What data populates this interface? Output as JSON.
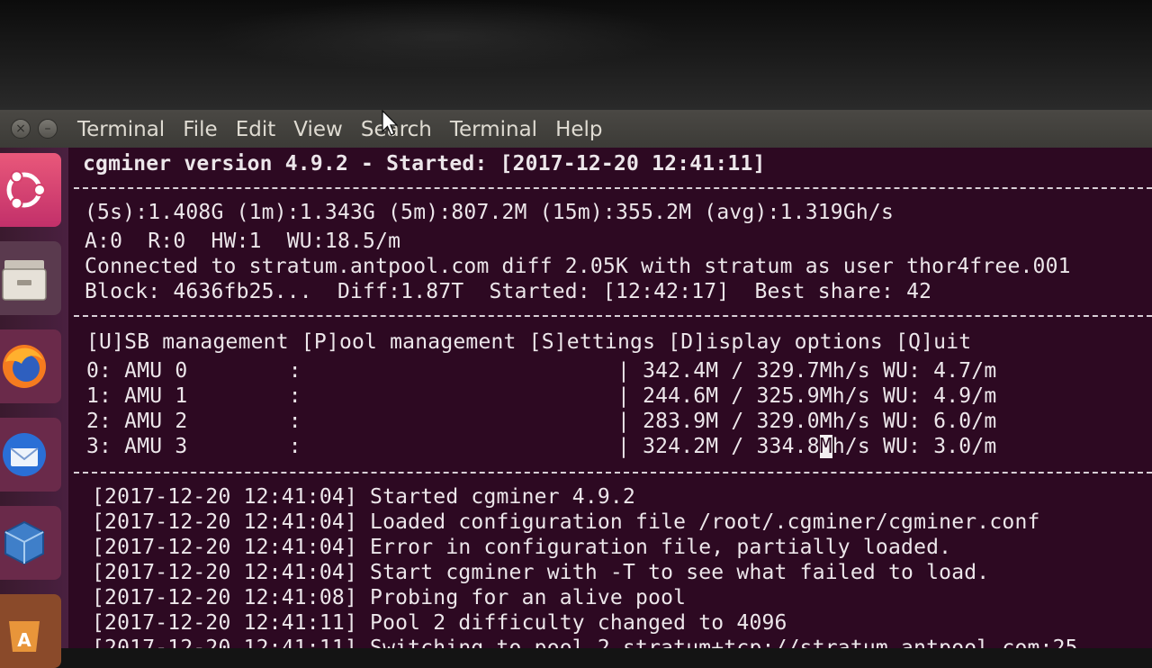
{
  "menubar": {
    "items": [
      "Terminal",
      "File",
      "Edit",
      "View",
      "Search",
      "Terminal",
      "Help"
    ]
  },
  "launcher": {
    "items": [
      "ubuntu-icon",
      "files-icon",
      "firefox-icon",
      "thunderbird-icon",
      "virtualbox-icon",
      "software-center-icon"
    ]
  },
  "terminal": {
    "header": "cgminer version 4.9.2 - Started: [2017-12-20 12:41:11]",
    "stats_rate": "(5s):1.408G (1m):1.343G (5m):807.2M (15m):355.2M (avg):1.319Gh/s",
    "stats_counts": "A:0  R:0  HW:1  WU:18.5/m",
    "connection": "Connected to stratum.antpool.com diff 2.05K with stratum as user thor4free.001",
    "block": "Block: 4636fb25...  Diff:1.87T  Started: [12:42:17]  Best share: 42",
    "menu": "[U]SB management [P]ool management [S]ettings [D]isplay options [Q]uit",
    "devices": [
      "0: AMU 0        :                         | 342.4M / 329.7Mh/s WU: 4.7/m",
      "1: AMU 1        :                         | 244.6M / 325.9Mh/s WU: 4.9/m",
      "2: AMU 2        :                         | 283.9M / 329.0Mh/s WU: 6.0/m"
    ],
    "device_last_before_cursor": "3: AMU 3        :                         | 324.2M / 334.8",
    "device_last_cursor_char": "M",
    "device_last_after_cursor": "h/s WU: 3.0/m",
    "log": [
      "[2017-12-20 12:41:04] Started cgminer 4.9.2",
      "[2017-12-20 12:41:04] Loaded configuration file /root/.cgminer/cgminer.conf",
      "[2017-12-20 12:41:04] Error in configuration file, partially loaded.",
      "[2017-12-20 12:41:04] Start cgminer with -T to see what failed to load.",
      "[2017-12-20 12:41:08] Probing for an alive pool",
      "[2017-12-20 12:41:11] Pool 2 difficulty changed to 4096",
      "[2017-12-20 12:41:11] Switching to pool 2 stratum+tcp://stratum.antpool.com:25"
    ]
  },
  "colors": {
    "terminal_bg": "#2d0922",
    "terminal_fg": "#ece6ea",
    "titlebar": "#3c3b37",
    "launcher_bg": "#4a2040"
  }
}
